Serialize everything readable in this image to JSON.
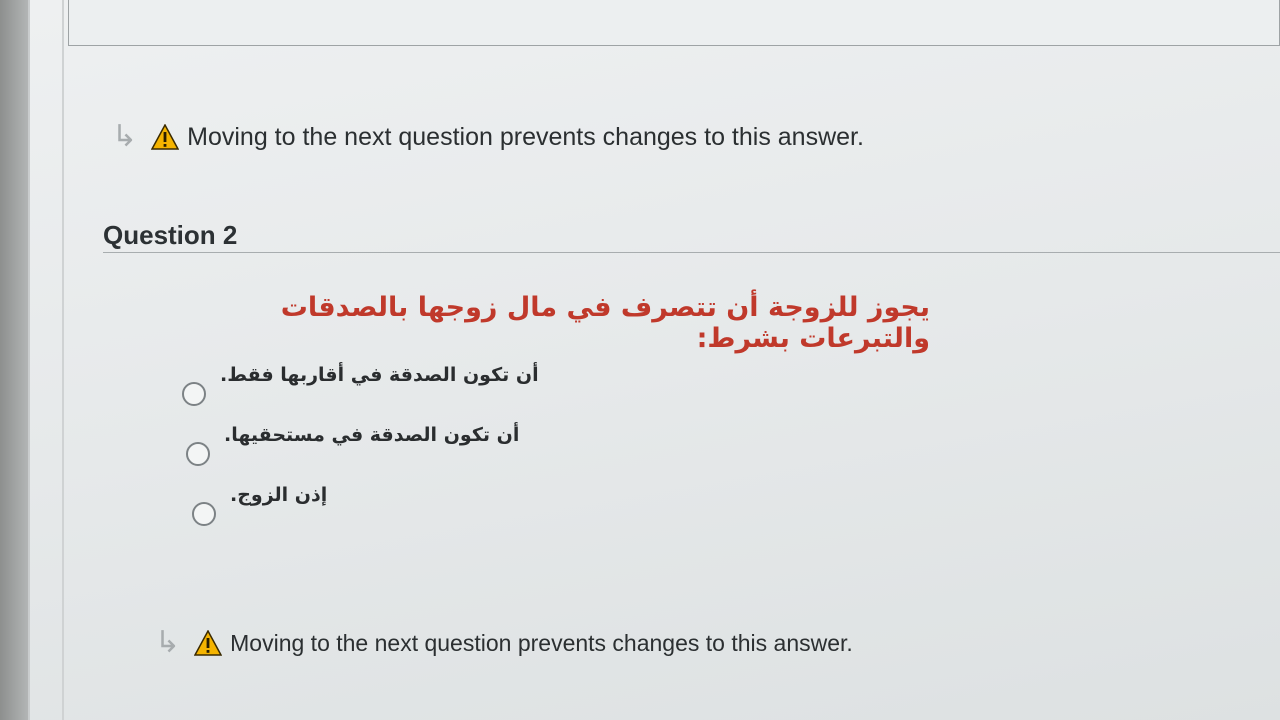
{
  "notices": [
    {
      "text": "Moving to the next question prevents changes to this answer."
    },
    {
      "text": "Moving to the next question prevents changes to this answer."
    }
  ],
  "question": {
    "title": "Question 2",
    "text": "يجوز للزوجة أن تتصرف في مال زوجها بالصدقات والتبرعات بشرط:",
    "options": [
      {
        "label": "أن تكون الصدقة في أقاربها فقط."
      },
      {
        "label": "أن تكون الصدقة في مستحقيها."
      },
      {
        "label": "إذن الزوج."
      }
    ]
  },
  "colors": {
    "question_text": "#c0392b",
    "warning_fill": "#f5b400"
  },
  "icons": {
    "arrow": "return-arrow-icon",
    "warning": "warning-triangle-icon",
    "radio": "radio-button"
  }
}
